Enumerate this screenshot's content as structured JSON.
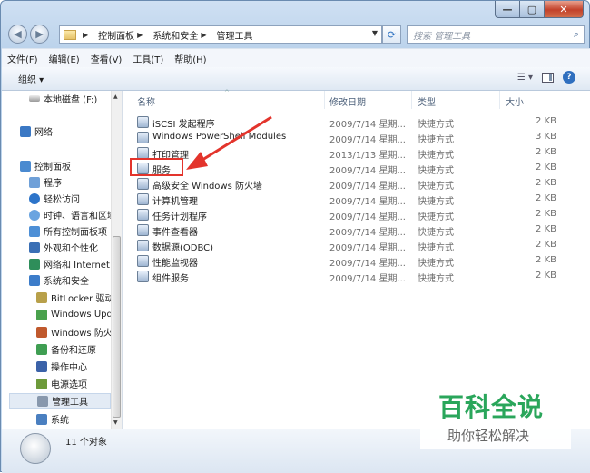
{
  "window": {
    "controls": {
      "minimize": "—",
      "maximize": "▢",
      "close": "✕"
    }
  },
  "nav": {
    "back_icon": "back-arrow-icon",
    "forward_icon": "forward-arrow-icon"
  },
  "address": {
    "breadcrumbs": [
      "控制面板",
      "系统和安全",
      "管理工具"
    ],
    "refresh_icon": "refresh-icon"
  },
  "search": {
    "placeholder": "搜索 管理工具"
  },
  "menu": [
    "文件(F)",
    "编辑(E)",
    "查看(V)",
    "工具(T)",
    "帮助(H)"
  ],
  "command_bar": {
    "organize": "组织 ▾",
    "help": "?"
  },
  "sidebar": {
    "items": [
      {
        "label": "本地磁盘 (F:)",
        "icon": "drive-icon"
      },
      {
        "label": "网络",
        "icon": "network-icon"
      },
      {
        "label": "控制面板",
        "icon": "control-panel-icon"
      },
      {
        "label": "程序",
        "icon": "programs-icon"
      },
      {
        "label": "轻松访问",
        "icon": "ease-of-access-icon"
      },
      {
        "label": "时钟、语言和区域",
        "icon": "clock-icon"
      },
      {
        "label": "所有控制面板项",
        "icon": "all-items-icon"
      },
      {
        "label": "外观和个性化",
        "icon": "appearance-icon"
      },
      {
        "label": "网络和 Internet",
        "icon": "network-internet-icon"
      },
      {
        "label": "系统和安全",
        "icon": "system-security-icon"
      },
      {
        "label": "BitLocker 驱动",
        "icon": "bitlocker-icon"
      },
      {
        "label": "Windows Upd",
        "icon": "windows-update-icon"
      },
      {
        "label": "Windows 防火",
        "icon": "firewall-icon"
      },
      {
        "label": "备份和还原",
        "icon": "backup-icon"
      },
      {
        "label": "操作中心",
        "icon": "action-center-icon"
      },
      {
        "label": "电源选项",
        "icon": "power-icon"
      },
      {
        "label": "管理工具",
        "icon": "admin-tools-icon"
      },
      {
        "label": "系统",
        "icon": "system-icon"
      }
    ]
  },
  "columns": {
    "name": "名称",
    "date": "修改日期",
    "type": "类型",
    "size": "大小"
  },
  "files": [
    {
      "name": "iSCSI 发起程序",
      "date": "2009/7/14 星期...",
      "type": "快捷方式",
      "size": "2 KB"
    },
    {
      "name": "Windows PowerShell Modules",
      "date": "2009/7/14 星期...",
      "type": "快捷方式",
      "size": "3 KB"
    },
    {
      "name": "打印管理",
      "date": "2013/1/13 星期...",
      "type": "快捷方式",
      "size": "2 KB"
    },
    {
      "name": "服务",
      "date": "2009/7/14 星期...",
      "type": "快捷方式",
      "size": "2 KB"
    },
    {
      "name": "高级安全 Windows 防火墙",
      "date": "2009/7/14 星期...",
      "type": "快捷方式",
      "size": "2 KB"
    },
    {
      "name": "计算机管理",
      "date": "2009/7/14 星期...",
      "type": "快捷方式",
      "size": "2 KB"
    },
    {
      "name": "任务计划程序",
      "date": "2009/7/14 星期...",
      "type": "快捷方式",
      "size": "2 KB"
    },
    {
      "name": "事件查看器",
      "date": "2009/7/14 星期...",
      "type": "快捷方式",
      "size": "2 KB"
    },
    {
      "name": "数据源(ODBC)",
      "date": "2009/7/14 星期...",
      "type": "快捷方式",
      "size": "2 KB"
    },
    {
      "name": "性能监视器",
      "date": "2009/7/14 星期...",
      "type": "快捷方式",
      "size": "2 KB"
    },
    {
      "name": "组件服务",
      "date": "2009/7/14 星期...",
      "type": "快捷方式",
      "size": "2 KB"
    }
  ],
  "status": {
    "count": "11 个对象"
  },
  "watermark": {
    "title": "百科全说",
    "subtitle": "助你轻松解决"
  },
  "colors": {
    "highlight_box": "#e3342c",
    "watermark_green": "#2aa65b"
  }
}
